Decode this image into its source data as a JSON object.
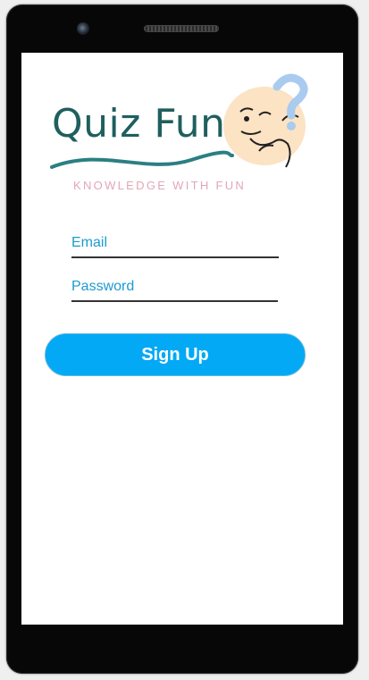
{
  "app": {
    "logo_title": "Quiz Fun",
    "logo_tagline": "KNOWLEDGE WITH FUN"
  },
  "form": {
    "email_placeholder": "Email",
    "email_value": "",
    "password_placeholder": "Password",
    "password_value": "",
    "submit_label": "Sign Up"
  },
  "colors": {
    "accent": "#03a9f4",
    "input_text": "#1b9bd1",
    "logo_text": "#1f5f5e",
    "tagline": "#e2a7b7",
    "device_body": "#070707"
  },
  "icons": {
    "logo_mascot": "thinking-face-icon",
    "question_mark": "question-mark-icon"
  }
}
